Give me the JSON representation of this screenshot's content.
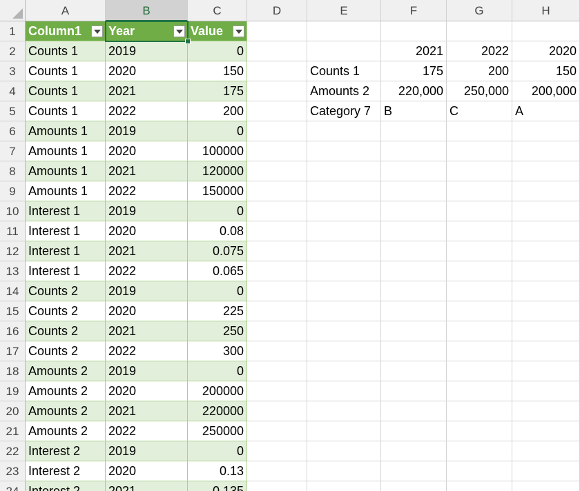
{
  "columns": [
    "A",
    "B",
    "C",
    "D",
    "E",
    "F",
    "G",
    "H"
  ],
  "selected_column": "B",
  "table": {
    "headers": [
      "Column1",
      "Year",
      "Value"
    ],
    "rows": [
      [
        "Counts 1",
        "2019",
        "0"
      ],
      [
        "Counts 1",
        "2020",
        "150"
      ],
      [
        "Counts 1",
        "2021",
        "175"
      ],
      [
        "Counts 1",
        "2022",
        "200"
      ],
      [
        "Amounts 1",
        "2019",
        "0"
      ],
      [
        "Amounts 1",
        "2020",
        "100000"
      ],
      [
        "Amounts 1",
        "2021",
        "120000"
      ],
      [
        "Amounts 1",
        "2022",
        "150000"
      ],
      [
        "Interest 1",
        "2019",
        "0"
      ],
      [
        "Interest 1",
        "2020",
        "0.08"
      ],
      [
        "Interest 1",
        "2021",
        "0.075"
      ],
      [
        "Interest 1",
        "2022",
        "0.065"
      ],
      [
        "Counts 2",
        "2019",
        "0"
      ],
      [
        "Counts 2",
        "2020",
        "225"
      ],
      [
        "Counts 2",
        "2021",
        "250"
      ],
      [
        "Counts 2",
        "2022",
        "300"
      ],
      [
        "Amounts 2",
        "2019",
        "0"
      ],
      [
        "Amounts 2",
        "2020",
        "200000"
      ],
      [
        "Amounts 2",
        "2021",
        "220000"
      ],
      [
        "Amounts 2",
        "2022",
        "250000"
      ],
      [
        "Interest 2",
        "2019",
        "0"
      ],
      [
        "Interest 2",
        "2020",
        "0.13"
      ],
      [
        "Interest 2",
        "2021",
        "0.135"
      ]
    ]
  },
  "summary": {
    "headers": [
      "",
      "2021",
      "2022",
      "2020"
    ],
    "rows": [
      [
        "Counts 1",
        "175",
        "200",
        "150"
      ],
      [
        "Amounts 2",
        "220,000",
        "250,000",
        "200,000"
      ],
      [
        "Category 7",
        "B",
        "C",
        "A"
      ]
    ]
  },
  "colors": {
    "table_header": "#70ad47",
    "band": "#e2efda",
    "selection": "#217346"
  }
}
